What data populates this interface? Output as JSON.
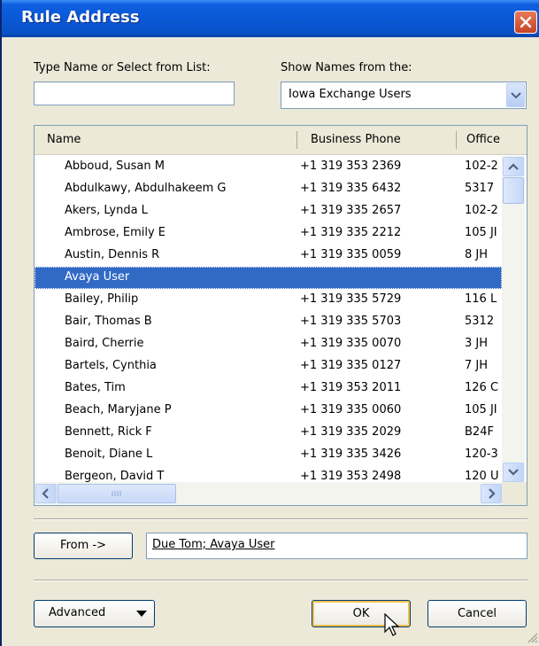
{
  "window": {
    "title": "Rule Address"
  },
  "search": {
    "label": "Type Name or Select from List:",
    "value": ""
  },
  "address_book": {
    "label": "Show Names from the:",
    "selected": "Iowa Exchange Users"
  },
  "list": {
    "columns": [
      "Name",
      "Business Phone",
      "Office"
    ],
    "rows": [
      {
        "name": "Abboud, Susan M",
        "phone": "+1 319 353 2369",
        "office": "102-2"
      },
      {
        "name": "Abdulkawy, Abdulhakeem G",
        "phone": "+1 319 335 6432",
        "office": "5317"
      },
      {
        "name": "Akers, Lynda L",
        "phone": "+1 319 335 2657",
        "office": "102-2"
      },
      {
        "name": "Ambrose, Emily E",
        "phone": "+1 319 335 2212",
        "office": "105 JI"
      },
      {
        "name": "Austin, Dennis R",
        "phone": "+1 319 335 0059",
        "office": "8 JH"
      },
      {
        "name": "Avaya User",
        "phone": "",
        "office": "",
        "selected": true
      },
      {
        "name": "Bailey, Philip",
        "phone": "+1 319 335 5729",
        "office": "116 L"
      },
      {
        "name": "Bair, Thomas B",
        "phone": "+1 319 335 5703",
        "office": "5312"
      },
      {
        "name": "Baird, Cherrie",
        "phone": "+1 319 335 0070",
        "office": "3 JH"
      },
      {
        "name": "Bartels, Cynthia",
        "phone": "+1 319 335 0127",
        "office": "7 JH"
      },
      {
        "name": "Bates, Tim",
        "phone": "+1 319 353 2011",
        "office": "126 C"
      },
      {
        "name": "Beach, Maryjane P",
        "phone": "+1 319 335 0060",
        "office": "105 JI"
      },
      {
        "name": "Bennett, Rick F",
        "phone": "+1 319 335 2029",
        "office": "B24F"
      },
      {
        "name": "Benoit, Diane L",
        "phone": "+1 319 335 3426",
        "office": "120-3"
      },
      {
        "name": "Bergeon, David T",
        "phone": "+1 319 353 2498",
        "office": "120 U"
      }
    ]
  },
  "from": {
    "button_label": "From ->",
    "value": "Due Tom; Avaya User"
  },
  "footer": {
    "advanced_label": "Advanced",
    "ok_label": "OK",
    "cancel_label": "Cancel"
  },
  "icons": {
    "close": "close-icon",
    "dropdown": "chevron-down-icon",
    "scroll_up": "arrow-up-icon",
    "scroll_down": "arrow-down-icon",
    "scroll_left": "arrow-left-icon",
    "scroll_right": "arrow-right-icon",
    "cursor": "mouse-pointer-icon"
  },
  "colors": {
    "titlebar": "#0a58d6",
    "selection": "#316ac5",
    "dialog": "#ece9d8"
  }
}
